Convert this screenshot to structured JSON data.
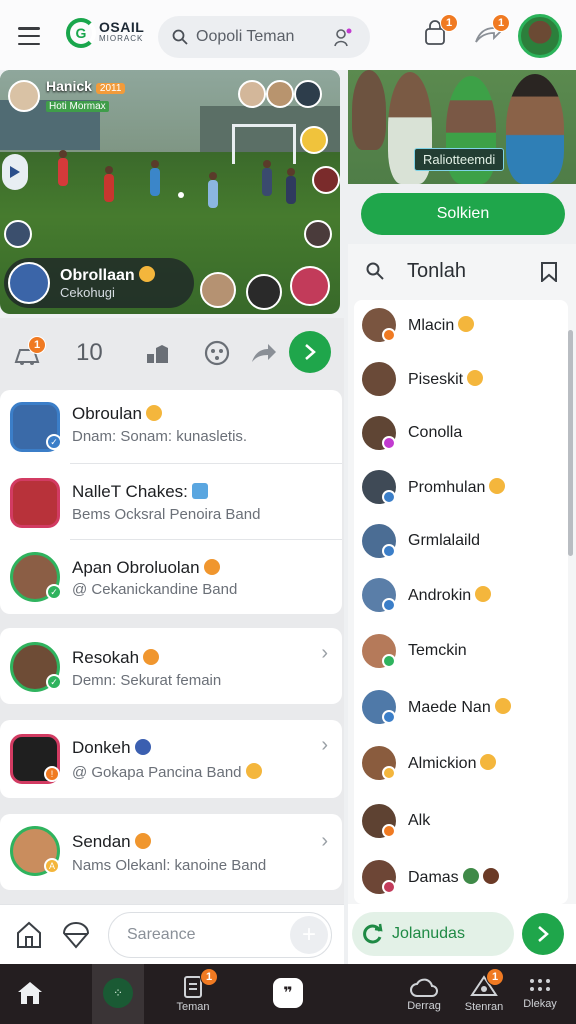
{
  "header": {
    "logo_title": "OSAIL",
    "logo_sub": "MIORACK",
    "search_placeholder": "Oopoli Teman",
    "bag_badge": "1",
    "share_badge": "1"
  },
  "video": {
    "host_name": "Hanick",
    "host_year": "2011",
    "host_sub": "Hoti Mormax",
    "caller_name": "Obrollaan",
    "caller_sub": "Cekohugi"
  },
  "photo": {
    "tag": "Raliotteemdi",
    "button": "Solkien"
  },
  "toolbar": {
    "notif_badge": "1",
    "count": "10"
  },
  "chats": [
    {
      "title": "Obroulan",
      "sub": "Dnam: Sonam: kunasletis."
    },
    {
      "title": "NalleT Chakes:",
      "sub": "Bems Ocksral Penoira Band"
    },
    {
      "title": "Apan Obroluolan",
      "sub": "@ Cekanickandine Band"
    },
    {
      "title": "Resokah",
      "sub": "Demn: Sekurat femain"
    },
    {
      "title": "Donkeh",
      "sub": "@ Gokapa Pancina Band"
    },
    {
      "title": "Sendan",
      "sub": "Nams Olekanl: kanoine Band"
    }
  ],
  "composer": {
    "placeholder": "Sareance"
  },
  "contacts": {
    "title": "Tonlah",
    "items": [
      "Mlacin",
      "Piseskit",
      "Conolla",
      "Promhulan",
      "Grmlalaild",
      "Androkin",
      "Temckin",
      "Maede Nan",
      "Almickion",
      "Alk",
      "Damas"
    ]
  },
  "right_footer": {
    "label": "Jolanudas"
  },
  "nav": {
    "items": [
      {
        "label": ""
      },
      {
        "label": ""
      },
      {
        "label": "Teman",
        "badge": "1"
      },
      {
        "label": ""
      },
      {
        "label": "Derrag"
      },
      {
        "label": "Stenran",
        "badge": "1"
      },
      {
        "label": "Dlekay"
      }
    ]
  },
  "colors": {
    "accent": "#1fa64b",
    "badge": "#f07a22",
    "nav_bg": "#241e20"
  }
}
